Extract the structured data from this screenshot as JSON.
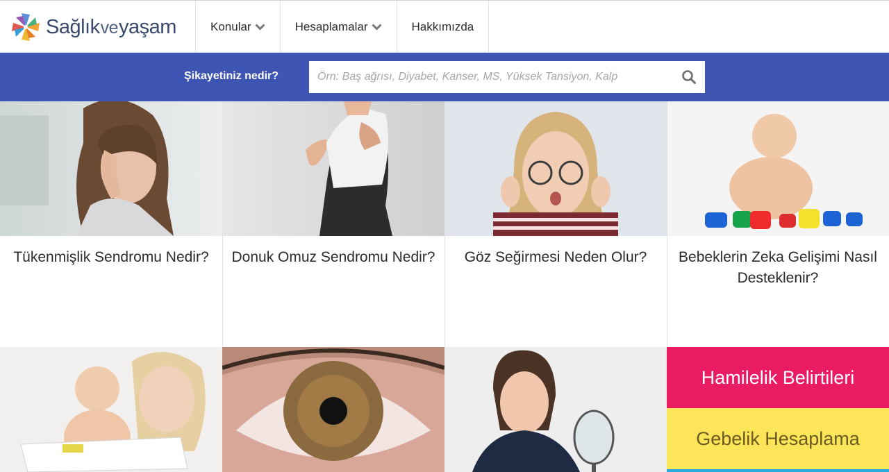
{
  "brand": {
    "name_part1": "Sağlık",
    "name_part2": "ve",
    "name_part3": "yaşam"
  },
  "nav": {
    "items": [
      {
        "label": "Konular",
        "has_dropdown": true
      },
      {
        "label": "Hesaplamalar",
        "has_dropdown": true
      },
      {
        "label": "Hakkımızda",
        "has_dropdown": false
      }
    ]
  },
  "search": {
    "label": "Şikayetiniz nedir?",
    "placeholder": "Örn: Baş ağrısı, Diyabet, Kanser, MS, Yüksek Tansiyon, Kalp",
    "icon": "search-icon"
  },
  "articles": [
    {
      "title": "Tükenmişlik Sendromu Nedir?",
      "image": "woman-headache-photo"
    },
    {
      "title": "Donuk Omuz Sendromu Nedir?",
      "image": "shoulder-pain-photo"
    },
    {
      "title": "Göz Seğirmesi Neden Olur?",
      "image": "woman-glasses-photo"
    },
    {
      "title": "Bebeklerin Zeka Gelişimi Nasıl Desteklenir?",
      "image": "baby-cups-photo"
    }
  ],
  "second_row": [
    {
      "image": "mother-baby-book-photo"
    },
    {
      "image": "eye-closeup-photo"
    },
    {
      "image": "woman-lipstick-mirror-photo"
    }
  ],
  "promos": {
    "pink_label": "Hamilelik Belirtileri",
    "yellow_label": "Gebelik Hesaplama"
  },
  "colors": {
    "search_band": "#3e55b4",
    "promo_pink": "#e91b63",
    "promo_yellow": "#fce559",
    "logo_text": "#3a4a6e"
  }
}
